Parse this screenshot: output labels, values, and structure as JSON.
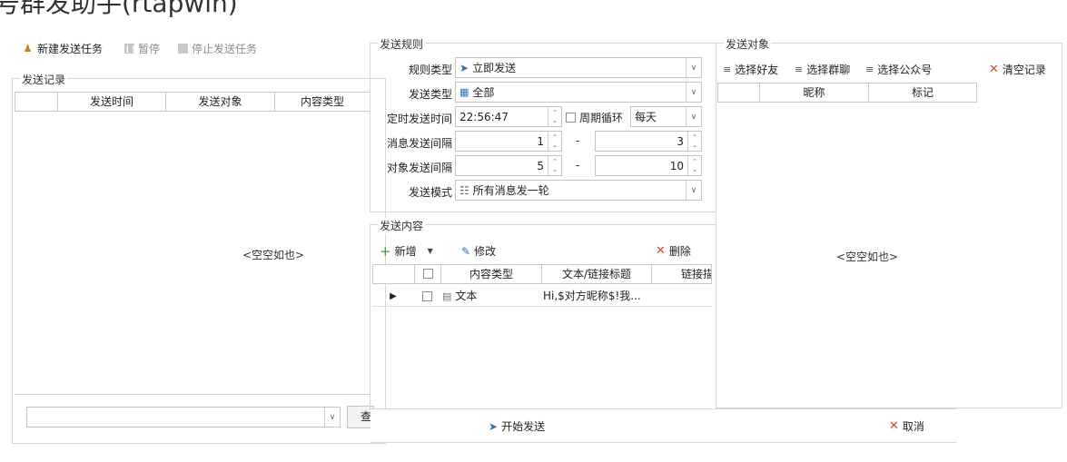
{
  "window": {
    "title_partial": "号群发助手(rtapwin)"
  },
  "toolbar": {
    "new_task": "新建发送任务",
    "pause": "暂停",
    "stop_task": "停止发送任务"
  },
  "record": {
    "legend": "发送记录",
    "columns": [
      "",
      "发送时间",
      "发送对象",
      "内容类型"
    ],
    "empty_text": "<空空如也>",
    "query_button": "查",
    "filter_value": ""
  },
  "rule": {
    "legend": "发送规则",
    "rule_type_label": "规则类型",
    "rule_type_value": "立即发送",
    "send_type_label": "发送类型",
    "send_type_value": "全部",
    "timed_label": "定时发送时间",
    "timed_value": "22:56:47",
    "cycle_label": "周期循环",
    "cycle_value": "每天",
    "msg_interval_label": "消息发送间隔",
    "msg_interval_min": "1",
    "msg_interval_max": "3",
    "obj_interval_label": "对象发送间隔",
    "obj_interval_min": "5",
    "obj_interval_max": "10",
    "dash": "-",
    "mode_label": "发送模式",
    "mode_value": "所有消息发一轮"
  },
  "content": {
    "legend": "发送内容",
    "add_label": "新增",
    "edit_label": "修改",
    "delete_label": "删除",
    "columns": [
      "",
      "",
      "内容类型",
      "文本/链接标题",
      "链接描"
    ],
    "rows": [
      {
        "type": "文本",
        "title": "Hi,$对方昵称$!我..."
      }
    ]
  },
  "target": {
    "legend": "发送对象",
    "select_friends": "选择好友",
    "select_groups": "选择群聊",
    "select_official": "选择公众号",
    "clear_records": "清空记录",
    "columns": [
      "",
      "昵称",
      "标记"
    ],
    "empty_text": "<空空如也>"
  },
  "footer": {
    "start_label": "开始发送",
    "cancel_label": "取消"
  },
  "colors": {
    "accent": "#2c6fc1",
    "danger": "#d84a2a",
    "add": "#3c9a43"
  }
}
